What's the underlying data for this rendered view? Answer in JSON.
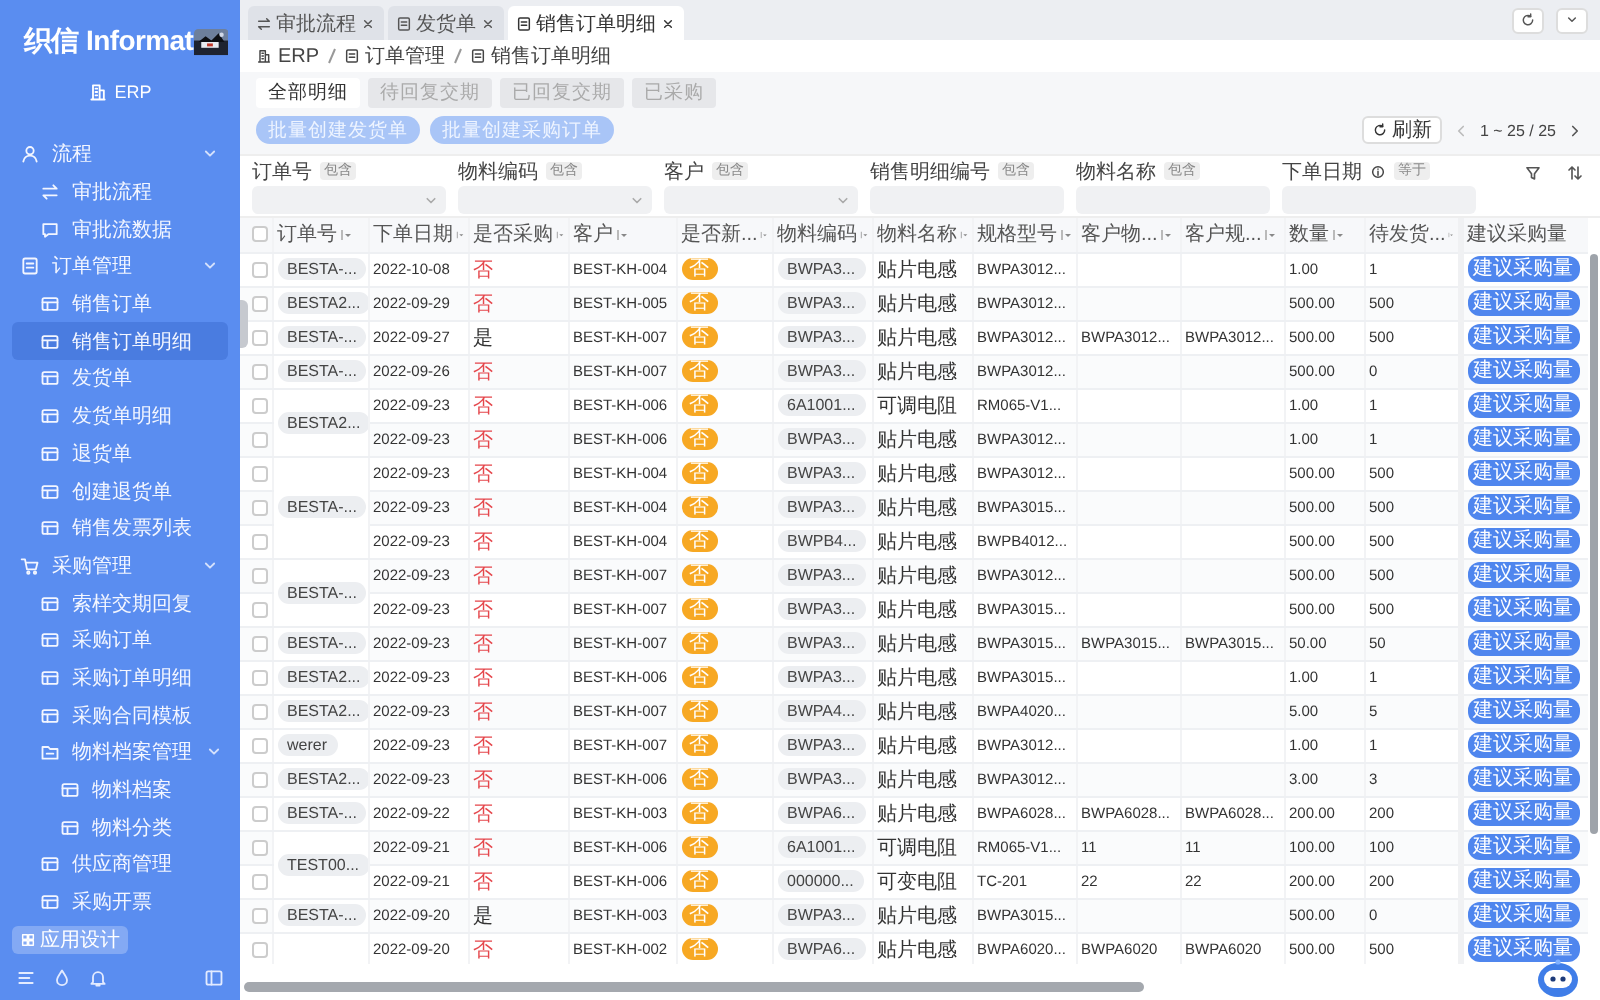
{
  "sidebar": {
    "brand": "织信 Informat",
    "app": "ERP",
    "design_button": "应用设计",
    "menu": [
      {
        "label": "流程",
        "expanded": true,
        "children": [
          {
            "label": "审批流程",
            "selected": false
          },
          {
            "label": "审批流数据",
            "selected": false
          }
        ]
      },
      {
        "label": "订单管理",
        "expanded": true,
        "children": [
          {
            "label": "销售订单",
            "selected": false
          },
          {
            "label": "销售订单明细",
            "selected": true
          },
          {
            "label": "发货单",
            "selected": false
          },
          {
            "label": "发货单明细",
            "selected": false
          },
          {
            "label": "退货单",
            "selected": false
          },
          {
            "label": "创建退货单",
            "selected": false
          },
          {
            "label": "销售发票列表",
            "selected": false
          }
        ]
      },
      {
        "label": "采购管理",
        "expanded": true,
        "children": [
          {
            "label": "索样交期回复",
            "selected": false
          },
          {
            "label": "采购订单",
            "selected": false
          },
          {
            "label": "采购订单明细",
            "selected": false
          },
          {
            "label": "采购合同模板",
            "selected": false
          },
          {
            "label": "物料档案管理",
            "expanded": true,
            "children": [
              {
                "label": "物料档案",
                "selected": false
              },
              {
                "label": "物料分类",
                "selected": false
              }
            ]
          },
          {
            "label": "供应商管理",
            "selected": false
          },
          {
            "label": "采购开票",
            "selected": false
          }
        ]
      }
    ]
  },
  "tabs": [
    {
      "label": "审批流程",
      "selected": false
    },
    {
      "label": "发货单",
      "selected": false
    },
    {
      "label": "销售订单明细",
      "selected": true
    }
  ],
  "breadcrumb": [
    "ERP",
    "订单管理",
    "销售订单明细"
  ],
  "view_tabs": [
    {
      "label": "全部明细",
      "selected": true
    },
    {
      "label": "待回复交期",
      "selected": false
    },
    {
      "label": "已回复交期",
      "selected": false
    },
    {
      "label": "已采购",
      "selected": false
    }
  ],
  "actions": [
    {
      "label": "批量创建发货单",
      "disabled": true
    },
    {
      "label": "批量创建采购订单",
      "disabled": true
    }
  ],
  "refresh": "刷新",
  "pagination": "1 ~ 25 / 25",
  "filters": [
    {
      "label": "订单号",
      "operator": "包含",
      "kind": "select"
    },
    {
      "label": "物料编码",
      "operator": "包含",
      "kind": "select"
    },
    {
      "label": "客户",
      "operator": "包含",
      "kind": "select"
    },
    {
      "label": "销售明细编号",
      "operator": "包含",
      "kind": "text"
    },
    {
      "label": "物料名称",
      "operator": "包含",
      "kind": "text"
    },
    {
      "label": "下单日期",
      "operator": "等于",
      "kind": "date"
    }
  ],
  "table": {
    "all_checked": false,
    "columns": [
      {
        "label": "订单号",
        "sortable": true
      },
      {
        "label": "下单日期",
        "sortable": true
      },
      {
        "label": "是否采购",
        "sortable": true
      },
      {
        "label": "客户",
        "sortable": true
      },
      {
        "label": "是否新...",
        "sortable": true
      },
      {
        "label": "物料编码",
        "sortable": true
      },
      {
        "label": "物料名称",
        "sortable": true
      },
      {
        "label": "规格型号",
        "sortable": true
      },
      {
        "label": "客户物...",
        "sortable": true
      },
      {
        "label": "客户规...",
        "sortable": true
      },
      {
        "label": "数量",
        "sortable": true
      },
      {
        "label": "待发货...",
        "sortable": true
      },
      {
        "label": "建议采购量",
        "sortable": false
      }
    ],
    "orders": [
      {
        "order_no": "BESTA-...",
        "lines": [
          {
            "checked": false,
            "date": "2022-10-08",
            "purchased": false,
            "purchased_label": "否",
            "customer": "BEST-KH-004",
            "new_label": "否",
            "material_code": "BWPA3...",
            "material_name": "贴片电感",
            "spec": "BWPA3012...",
            "qty": "1.00",
            "pending": "1",
            "action": "建议采购量"
          }
        ]
      },
      {
        "order_no": "BESTA2...",
        "lines": [
          {
            "checked": false,
            "date": "2022-09-29",
            "purchased": false,
            "purchased_label": "否",
            "customer": "BEST-KH-005",
            "new_label": "否",
            "material_code": "BWPA3...",
            "material_name": "贴片电感",
            "spec": "BWPA3012...",
            "qty": "500.00",
            "pending": "500",
            "action": "建议采购量"
          }
        ]
      },
      {
        "order_no": "BESTA-...",
        "lines": [
          {
            "checked": false,
            "date": "2022-09-27",
            "purchased": true,
            "purchased_label": "是",
            "customer": "BEST-KH-007",
            "new_label": "否",
            "material_code": "BWPA3...",
            "material_name": "贴片电感",
            "spec": "BWPA3012...",
            "customer_material": "BWPA3012...",
            "customer_spec": "BWPA3012...",
            "qty": "500.00",
            "pending": "500",
            "action": "建议采购量"
          }
        ]
      },
      {
        "order_no": "BESTA-...",
        "lines": [
          {
            "checked": false,
            "date": "2022-09-26",
            "purchased": false,
            "purchased_label": "否",
            "customer": "BEST-KH-007",
            "new_label": "否",
            "material_code": "BWPA3...",
            "material_name": "贴片电感",
            "spec": "BWPA3012...",
            "qty": "500.00",
            "pending": "0",
            "action": "建议采购量"
          }
        ]
      },
      {
        "order_no": "BESTA2...",
        "lines": [
          {
            "checked": false,
            "date": "2022-09-23",
            "purchased": false,
            "purchased_label": "否",
            "customer": "BEST-KH-006",
            "new_label": "否",
            "material_code": "6A1001...",
            "material_name": "可调电阻",
            "spec": "RM065-V1...",
            "qty": "1.00",
            "pending": "1",
            "action": "建议采购量"
          },
          {
            "checked": false,
            "date": "2022-09-23",
            "purchased": false,
            "purchased_label": "否",
            "customer": "BEST-KH-006",
            "new_label": "否",
            "material_code": "BWPA3...",
            "material_name": "贴片电感",
            "spec": "BWPA3012...",
            "qty": "1.00",
            "pending": "1",
            "action": "建议采购量"
          }
        ]
      },
      {
        "order_no": "BESTA-...",
        "lines": [
          {
            "checked": false,
            "date": "2022-09-23",
            "purchased": false,
            "purchased_label": "否",
            "customer": "BEST-KH-004",
            "new_label": "否",
            "material_code": "BWPA3...",
            "material_name": "贴片电感",
            "spec": "BWPA3012...",
            "qty": "500.00",
            "pending": "500",
            "action": "建议采购量"
          },
          {
            "checked": false,
            "date": "2022-09-23",
            "purchased": false,
            "purchased_label": "否",
            "customer": "BEST-KH-004",
            "new_label": "否",
            "material_code": "BWPA3...",
            "material_name": "贴片电感",
            "spec": "BWPA3015...",
            "qty": "500.00",
            "pending": "500",
            "action": "建议采购量"
          },
          {
            "checked": false,
            "date": "2022-09-23",
            "purchased": false,
            "purchased_label": "否",
            "customer": "BEST-KH-004",
            "new_label": "否",
            "material_code": "BWPB4...",
            "material_name": "贴片电感",
            "spec": "BWPB4012...",
            "qty": "500.00",
            "pending": "500",
            "action": "建议采购量"
          }
        ]
      },
      {
        "order_no": "BESTA-...",
        "lines": [
          {
            "checked": false,
            "date": "2022-09-23",
            "purchased": false,
            "purchased_label": "否",
            "customer": "BEST-KH-007",
            "new_label": "否",
            "material_code": "BWPA3...",
            "material_name": "贴片电感",
            "spec": "BWPA3012...",
            "qty": "500.00",
            "pending": "500",
            "action": "建议采购量"
          },
          {
            "checked": false,
            "date": "2022-09-23",
            "purchased": false,
            "purchased_label": "否",
            "customer": "BEST-KH-007",
            "new_label": "否",
            "material_code": "BWPA3...",
            "material_name": "贴片电感",
            "spec": "BWPA3015...",
            "qty": "500.00",
            "pending": "500",
            "action": "建议采购量"
          }
        ]
      },
      {
        "order_no": "BESTA-...",
        "lines": [
          {
            "checked": false,
            "date": "2022-09-23",
            "purchased": false,
            "purchased_label": "否",
            "customer": "BEST-KH-007",
            "new_label": "否",
            "material_code": "BWPA3...",
            "material_name": "贴片电感",
            "spec": "BWPA3015...",
            "customer_material": "BWPA3015...",
            "customer_spec": "BWPA3015...",
            "qty": "50.00",
            "pending": "50",
            "action": "建议采购量"
          }
        ]
      },
      {
        "order_no": "BESTA2...",
        "lines": [
          {
            "checked": false,
            "date": "2022-09-23",
            "purchased": false,
            "purchased_label": "否",
            "customer": "BEST-KH-006",
            "new_label": "否",
            "material_code": "BWPA3...",
            "material_name": "贴片电感",
            "spec": "BWPA3015...",
            "qty": "1.00",
            "pending": "1",
            "action": "建议采购量"
          }
        ]
      },
      {
        "order_no": "BESTA2...",
        "lines": [
          {
            "checked": false,
            "date": "2022-09-23",
            "purchased": false,
            "purchased_label": "否",
            "customer": "BEST-KH-007",
            "new_label": "否",
            "material_code": "BWPA4...",
            "material_name": "贴片电感",
            "spec": "BWPA4020...",
            "qty": "5.00",
            "pending": "5",
            "action": "建议采购量"
          }
        ]
      },
      {
        "order_no": "werer",
        "lines": [
          {
            "checked": false,
            "date": "2022-09-23",
            "purchased": false,
            "purchased_label": "否",
            "customer": "BEST-KH-007",
            "new_label": "否",
            "material_code": "BWPA3...",
            "material_name": "贴片电感",
            "spec": "BWPA3012...",
            "qty": "1.00",
            "pending": "1",
            "action": "建议采购量"
          }
        ]
      },
      {
        "order_no": "BESTA2...",
        "lines": [
          {
            "checked": false,
            "date": "2022-09-23",
            "purchased": false,
            "purchased_label": "否",
            "customer": "BEST-KH-006",
            "new_label": "否",
            "material_code": "BWPA3...",
            "material_name": "贴片电感",
            "spec": "BWPA3012...",
            "qty": "3.00",
            "pending": "3",
            "action": "建议采购量"
          }
        ]
      },
      {
        "order_no": "BESTA-...",
        "lines": [
          {
            "checked": false,
            "date": "2022-09-22",
            "purchased": false,
            "purchased_label": "否",
            "customer": "BEST-KH-003",
            "new_label": "否",
            "material_code": "BWPA6...",
            "material_name": "贴片电感",
            "spec": "BWPA6028...",
            "customer_material": "BWPA6028...",
            "customer_spec": "BWPA6028...",
            "qty": "200.00",
            "pending": "200",
            "action": "建议采购量"
          }
        ]
      },
      {
        "order_no": "TEST00...",
        "lines": [
          {
            "checked": false,
            "date": "2022-09-21",
            "purchased": false,
            "purchased_label": "否",
            "customer": "BEST-KH-006",
            "new_label": "否",
            "material_code": "6A1001...",
            "material_name": "可调电阻",
            "spec": "RM065-V1...",
            "customer_material": "11",
            "customer_spec": "11",
            "qty": "100.00",
            "pending": "100",
            "action": "建议采购量"
          },
          {
            "checked": false,
            "date": "2022-09-21",
            "purchased": false,
            "purchased_label": "否",
            "customer": "BEST-KH-006",
            "new_label": "否",
            "material_code": "000000...",
            "material_name": "可变电阻",
            "spec": "TC-201",
            "customer_material": "22",
            "customer_spec": "22",
            "qty": "200.00",
            "pending": "200",
            "action": "建议采购量"
          }
        ]
      },
      {
        "order_no": "BESTA-...",
        "lines": [
          {
            "checked": false,
            "date": "2022-09-20",
            "purchased": true,
            "purchased_label": "是",
            "customer": "BEST-KH-003",
            "new_label": "否",
            "material_code": "BWPA3...",
            "material_name": "贴片电感",
            "spec": "BWPA3015...",
            "qty": "500.00",
            "pending": "0",
            "action": "建议采购量"
          }
        ]
      },
      {
        "lines": [
          {
            "checked": false,
            "date": "2022-09-20",
            "purchased": false,
            "purchased_label": "否",
            "customer": "BEST-KH-002",
            "new_label": "否",
            "material_code": "BWPA6...",
            "material_name": "贴片电感",
            "spec": "BWPA6020...",
            "customer_material": "BWPA6020",
            "customer_spec": "BWPA6020",
            "qty": "500.00",
            "pending": "500",
            "action": "建议采购量"
          }
        ]
      }
    ]
  }
}
